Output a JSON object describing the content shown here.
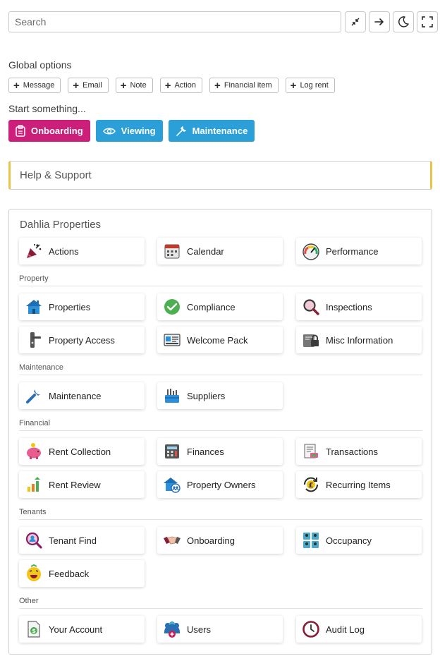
{
  "search": {
    "placeholder": "Search"
  },
  "toolbar": {
    "collapse_icon": "collapse-icon",
    "arrow_icon": "arrow-right-icon",
    "moon_icon": "moon-icon",
    "fullscreen_icon": "fullscreen-icon"
  },
  "global_options": {
    "title": "Global options",
    "items": [
      "Message",
      "Email",
      "Note",
      "Action",
      "Financial item",
      "Log rent"
    ]
  },
  "start": {
    "title": "Start something...",
    "buttons": [
      {
        "label": "Onboarding",
        "color": "#cc1f7a",
        "icon": "clipboard-icon"
      },
      {
        "label": "Viewing",
        "color": "#2b9fd8",
        "icon": "eye-icon"
      },
      {
        "label": "Maintenance",
        "color": "#2b9fd8",
        "icon": "wrench-icon"
      }
    ]
  },
  "help": {
    "label": "Help & Support",
    "accent": "#e8c44a"
  },
  "panel": {
    "title": "Dahlia Properties",
    "top": [
      {
        "label": "Actions",
        "icon": "party-popper-icon"
      },
      {
        "label": "Calendar",
        "icon": "calendar-icon"
      },
      {
        "label": "Performance",
        "icon": "gauge-icon"
      }
    ],
    "categories": [
      {
        "name": "Property",
        "items": [
          {
            "label": "Properties",
            "icon": "house-icon"
          },
          {
            "label": "Compliance",
            "icon": "check-circle-icon"
          },
          {
            "label": "Inspections",
            "icon": "magnifier-icon"
          },
          {
            "label": "Property Access",
            "icon": "door-handle-icon"
          },
          {
            "label": "Welcome Pack",
            "icon": "id-card-icon"
          },
          {
            "label": "Misc Information",
            "icon": "lock-box-icon"
          }
        ]
      },
      {
        "name": "Maintenance",
        "items": [
          {
            "label": "Maintenance",
            "icon": "wrench-icon"
          },
          {
            "label": "Suppliers",
            "icon": "toolbox-icon"
          }
        ]
      },
      {
        "name": "Financial",
        "items": [
          {
            "label": "Rent Collection",
            "icon": "piggy-bank-icon"
          },
          {
            "label": "Finances",
            "icon": "calculator-icon"
          },
          {
            "label": "Transactions",
            "icon": "receipt-icon"
          },
          {
            "label": "Rent Review",
            "icon": "growth-chart-icon"
          },
          {
            "label": "Property Owners",
            "icon": "house-people-icon"
          },
          {
            "label": "Recurring Items",
            "icon": "pound-cycle-icon"
          }
        ]
      },
      {
        "name": "Tenants",
        "items": [
          {
            "label": "Tenant Find",
            "icon": "person-search-icon"
          },
          {
            "label": "Onboarding",
            "icon": "handshake-icon"
          },
          {
            "label": "Occupancy",
            "icon": "people-grid-icon"
          },
          {
            "label": "Feedback",
            "icon": "smiley-icon"
          }
        ]
      },
      {
        "name": "Other",
        "items": [
          {
            "label": "Your Account",
            "icon": "account-document-icon"
          },
          {
            "label": "Users",
            "icon": "users-add-icon"
          },
          {
            "label": "Audit Log",
            "icon": "clock-icon"
          }
        ]
      }
    ]
  }
}
